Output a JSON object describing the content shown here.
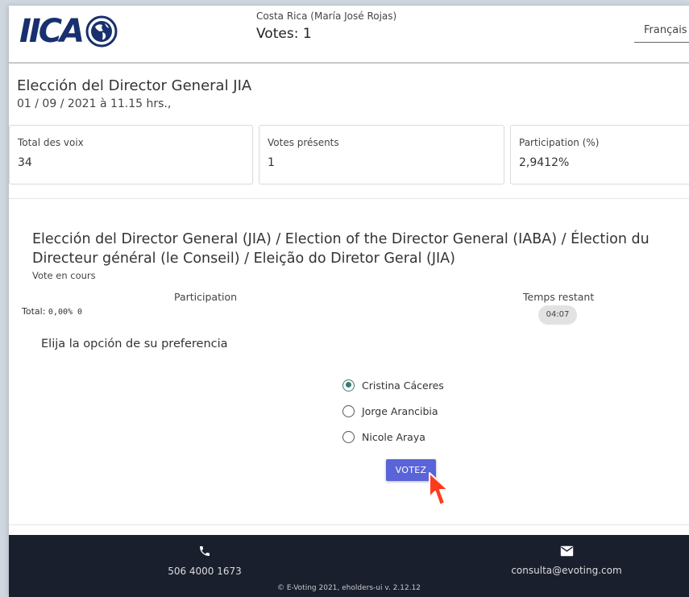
{
  "header": {
    "logo_text": "IICA",
    "user_name": "Costa Rica (María José Rojas)",
    "votes_line": "Votes: 1",
    "language": "Français"
  },
  "election": {
    "title": "Elección del Director General JIA",
    "date": "01 / 09 / 2021 à 11.15 hrs.,"
  },
  "stats": [
    {
      "label": "Total des voix",
      "value": "34"
    },
    {
      "label": "Votes présents",
      "value": "1"
    },
    {
      "label": "Participation (%)",
      "value": "2,9412%"
    }
  ],
  "ballot": {
    "title": "Elección del Director General (JIA) / Election of the Director General (IABA) / Élection du Directeur général (le Conseil) / Eleição do Diretor Geral (JIA)",
    "status": "Vote en cours",
    "participation_label": "Participation",
    "total_label": "Total:",
    "total_value": "0,00% 0",
    "time_label": "Temps restant",
    "time_value": "04:07",
    "prompt": "Elija la opción de su preferencia",
    "options": [
      {
        "label": "Cristina Cáceres",
        "selected": true
      },
      {
        "label": "Jorge Arancibia",
        "selected": false
      },
      {
        "label": "Nicole Araya",
        "selected": false
      }
    ],
    "vote_button": "VOTEZ"
  },
  "footer": {
    "phone": "506 4000 1673",
    "email": "consulta@evoting.com",
    "copyright": "© E-Voting 2021, eholders-ui v. 2.12.12"
  },
  "colors": {
    "accent": "#5a64d8",
    "radio_selected": "#3b7a72",
    "footer_bg": "#1a1f2e",
    "logo": "#18306e",
    "cursor": "#ff3b1f"
  }
}
